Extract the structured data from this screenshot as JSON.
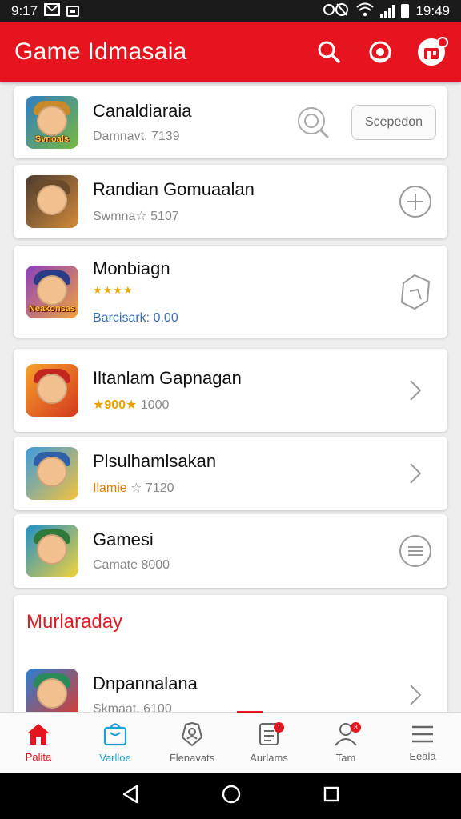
{
  "status_bar": {
    "time_left": "9:17",
    "time_right": "19:49"
  },
  "app_bar": {
    "title": "Game Idmasaia"
  },
  "list": [
    {
      "title": "Canaldiaraia",
      "subtitle": "Damnavt. 7139",
      "thumb_caption": "Svnoals",
      "action_label": "Scepedon",
      "theme": [
        "#2e7cc4",
        "#7bb83f"
      ]
    },
    {
      "title": "Randian Gomuaalan",
      "subtitle": "Swmna☆ 5107",
      "thumb_caption": "",
      "theme": [
        "#4b3b2e",
        "#d28a3b"
      ]
    },
    {
      "title": "Monbiagn",
      "rating_stars": "★★★★",
      "subtitle": "Barcisark: 0.00",
      "thumb_caption": "Neakonsas",
      "theme": [
        "#8b3fbf",
        "#f0a33c"
      ]
    },
    {
      "title": "Iltanlam Gapnagan",
      "rating": "★900★",
      "subtitle": "1000",
      "thumb_caption": "",
      "theme": [
        "#f6a12b",
        "#d4391f"
      ]
    },
    {
      "title": "Plsulhamlsakan",
      "subtitle_hl": "Ilamie",
      "subtitle": "☆ 7120",
      "thumb_caption": "",
      "theme": [
        "#3b9be0",
        "#f4c23c"
      ]
    },
    {
      "title": "Gamesi",
      "subtitle": "Camate 8000",
      "thumb_caption": "",
      "theme": [
        "#1e8fc9",
        "#f2d23a"
      ]
    }
  ],
  "section": {
    "title": "Murlaraday",
    "item": {
      "title": "Dnpannalana",
      "subtitle": "Skmaat. 6100",
      "theme": [
        "#2a7fd0",
        "#e03a2a"
      ]
    }
  },
  "bottom_nav": [
    {
      "label": "Palita",
      "icon": "home-icon",
      "state": "active"
    },
    {
      "label": "Varlloe",
      "icon": "shopping-bag-icon",
      "state": "alt"
    },
    {
      "label": "Flenavats",
      "icon": "user-badge-icon",
      "state": "normal"
    },
    {
      "label": "Aurlams",
      "icon": "document-icon",
      "state": "normal",
      "badge": "1"
    },
    {
      "label": "Tam",
      "icon": "person-icon",
      "state": "normal",
      "badge": "8"
    },
    {
      "label": "Eeala",
      "icon": "menu-icon",
      "state": "normal"
    }
  ],
  "colors": {
    "brand": "#e5141f",
    "accent_blue": "#1aa0d8"
  }
}
